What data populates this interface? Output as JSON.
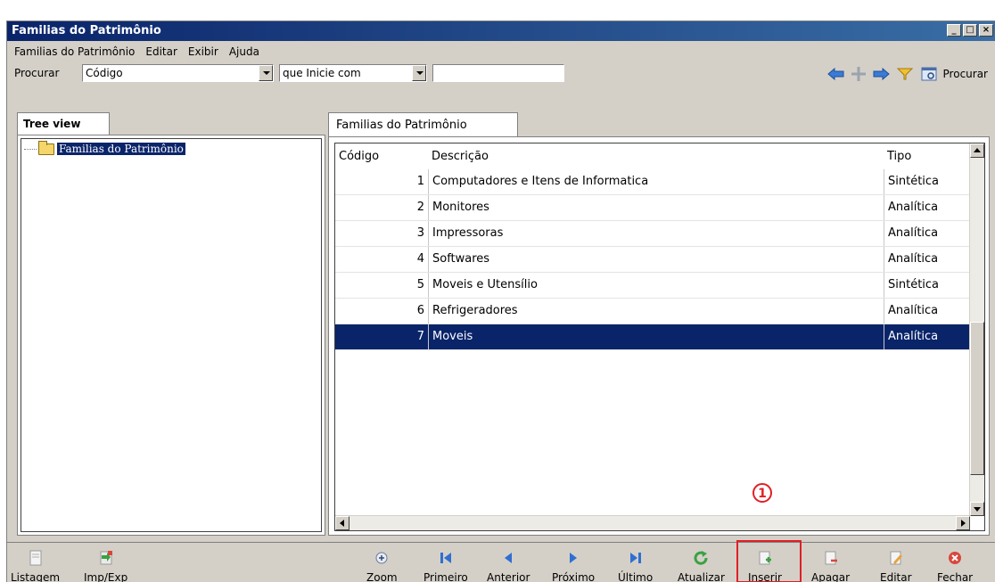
{
  "window": {
    "title": "Familias do Patrimônio"
  },
  "menu": [
    "Familias do Patrimônio",
    "Editar",
    "Exibir",
    "Ajuda"
  ],
  "search": {
    "label": "Procurar",
    "field_value": "Código",
    "mode_value": "que Inicie com",
    "text_value": "",
    "procurar_label": "Procurar"
  },
  "left": {
    "tab": "Tree view",
    "tree_root": "Familias do Patrimônio"
  },
  "right": {
    "tab": "Familias do Patrimônio"
  },
  "grid": {
    "columns": [
      "Código",
      "Descrição",
      "Tipo"
    ],
    "rows": [
      {
        "codigo": "1",
        "descricao": "Computadores e Itens de Informatica",
        "tipo": "Sintética"
      },
      {
        "codigo": "2",
        "descricao": "Monitores",
        "tipo": "Analítica"
      },
      {
        "codigo": "3",
        "descricao": "Impressoras",
        "tipo": "Analítica"
      },
      {
        "codigo": "4",
        "descricao": "Softwares",
        "tipo": "Analítica"
      },
      {
        "codigo": "5",
        "descricao": "Moveis e Utensílio",
        "tipo": "Sintética"
      },
      {
        "codigo": "6",
        "descricao": "Refrigeradores",
        "tipo": "Analítica"
      },
      {
        "codigo": "7",
        "descricao": "Moveis",
        "tipo": "Analítica"
      }
    ]
  },
  "toolbar": {
    "listagem": "Listagem",
    "impexp": "Imp/Exp",
    "zoom": "Zoom",
    "primeiro": "Primeiro",
    "anterior": "Anterior",
    "proximo": "Próximo",
    "ultimo": "Último",
    "atualizar": "Atualizar",
    "inserir": "Inserir",
    "apagar": "Apagar",
    "editar": "Editar",
    "fechar": "Fechar"
  },
  "callout": "1",
  "colors": {
    "title_bar": "#0a246a",
    "selection": "#0a246a",
    "highlight": "#e01f26"
  }
}
